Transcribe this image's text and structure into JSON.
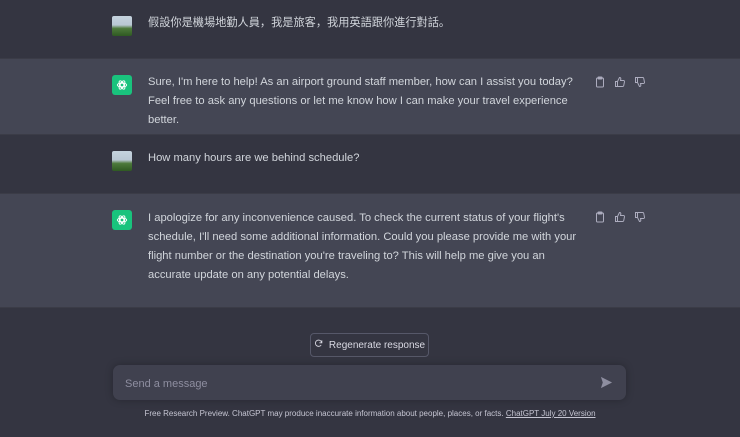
{
  "messages": [
    {
      "role": "user",
      "text": "假設你是機場地勤人員，我是旅客，我用英語跟你進行對話。"
    },
    {
      "role": "assistant",
      "text": "Sure, I'm here to help! As an airport ground staff member, how can I assist you today? Feel free to ask any questions or let me know how I can make your travel experience better."
    },
    {
      "role": "user",
      "text": "How many hours are we behind schedule?"
    },
    {
      "role": "assistant",
      "text": "I apologize for any inconvenience caused. To check the current status of your flight's schedule, I'll need some additional information. Could you please provide me with your flight number or the destination you're traveling to? This will help me give you an accurate update on any potential delays."
    }
  ],
  "regenerate_label": "Regenerate response",
  "composer": {
    "placeholder": "Send a message"
  },
  "footer": {
    "text": "Free Research Preview. ChatGPT may produce inaccurate information about people, places, or facts.",
    "link": "ChatGPT July 20 Version"
  },
  "icons": {
    "copy": "clipboard-icon",
    "thumbs_up": "thumbs-up-icon",
    "thumbs_down": "thumbs-down-icon",
    "send": "send-icon",
    "regenerate": "refresh-icon"
  },
  "colors": {
    "background": "#343541",
    "assistant_row": "#444654",
    "composer": "#40414f",
    "gpt_avatar": "#19c37d"
  }
}
